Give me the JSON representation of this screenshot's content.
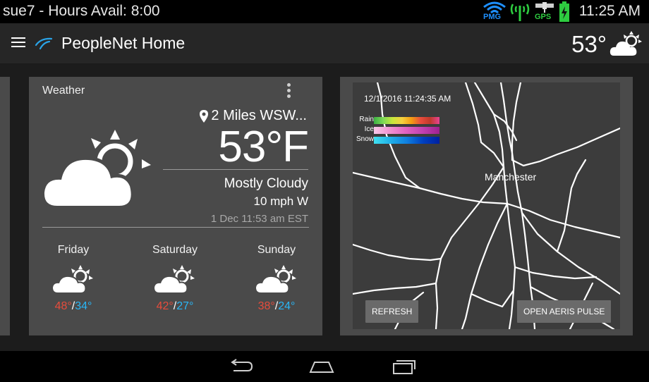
{
  "status_bar": {
    "left_text": "sue7 - Hours Avail: 8:00",
    "time": "11:25 AM",
    "indicators": [
      {
        "label": "PMG",
        "icon": "wifi-icon",
        "color": "#1e90ff"
      },
      {
        "label": "",
        "icon": "signal-tower-icon",
        "color": "#2ecc40"
      },
      {
        "label": "GPS",
        "icon": "satellite-icon",
        "color": "#2ecc40"
      },
      {
        "label": "",
        "icon": "battery-charging-icon",
        "color": "#2ecc40"
      }
    ]
  },
  "app_bar": {
    "title": "PeopleNet Home",
    "temp": "53°",
    "weather_icon": "partly-cloudy-icon"
  },
  "weather_card": {
    "title": "Weather",
    "location": "2 Miles WSW...",
    "temperature": "53°F",
    "condition": "Mostly Cloudy",
    "wind": "10 mph W",
    "updated": "1 Dec 11:53 am EST",
    "forecast": [
      {
        "day": "Friday",
        "high": "48°",
        "low": "34°",
        "icon": "partly-cloudy-icon"
      },
      {
        "day": "Saturday",
        "high": "42°",
        "low": "27°",
        "icon": "partly-cloudy-icon"
      },
      {
        "day": "Sunday",
        "high": "38°",
        "low": "24°",
        "icon": "partly-cloudy-icon"
      }
    ]
  },
  "radar_card": {
    "timestamp": "12/1/2016 11:24:35 AM",
    "legend": [
      {
        "label": "Rain"
      },
      {
        "label": "Ice"
      },
      {
        "label": "Snow"
      }
    ],
    "city": "Manchester",
    "refresh_label": "REFRESH",
    "open_label": "OPEN AERIS PULSE"
  },
  "colors": {
    "high_temp": "#e74c3c",
    "low_temp": "#29b6f6",
    "card_bg": "#4a4a4a",
    "app_bar_bg": "#262626"
  }
}
